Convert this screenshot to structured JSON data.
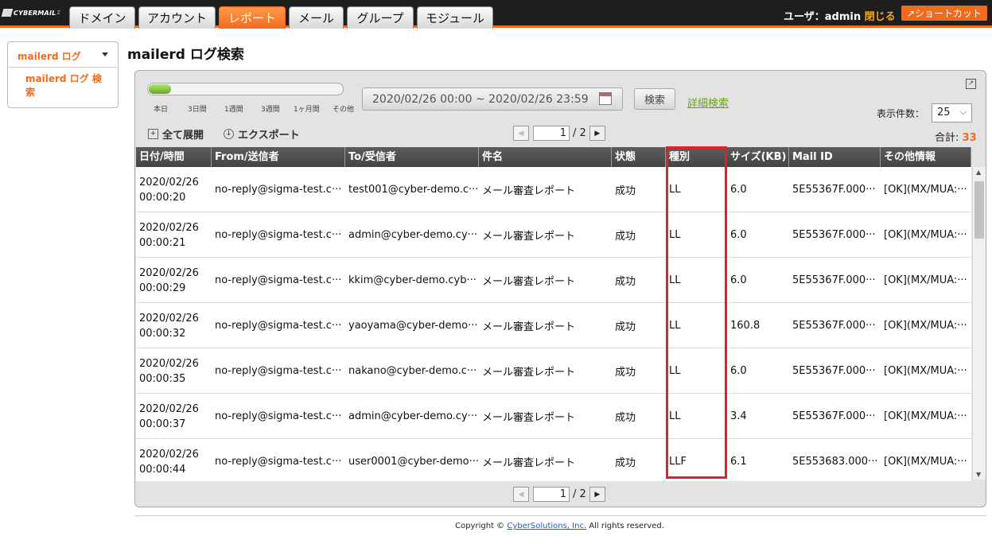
{
  "logo": {
    "text": "CYBERMAIL",
    "sup": "Σ"
  },
  "tabs": [
    {
      "label": "ドメイン"
    },
    {
      "label": "アカウント"
    },
    {
      "label": "レポート"
    },
    {
      "label": "メール"
    },
    {
      "label": "グループ"
    },
    {
      "label": "モジュール"
    }
  ],
  "active_tab": "レポート",
  "user": {
    "prefix": "ユーザ：admin",
    "close_label": "閉じる"
  },
  "shortcut_label": "ショートカット",
  "sidebar": {
    "header": "mailerd ログ",
    "item": "mailerd ログ 検索"
  },
  "page_title": "mailerd ログ検索",
  "slider_ticks": [
    "本日",
    "3日間",
    "1週間",
    "3週間",
    "1ヶ月間",
    "その他"
  ],
  "date_range": "2020/02/26 00:00 ~ 2020/02/26 23:59",
  "search_label": "検索",
  "advanced_search_label": "詳細検索",
  "per_page": {
    "label": "表示件数：",
    "value": "25"
  },
  "expand_all_label": "全て展開",
  "export_label": "エクスポート",
  "pager": {
    "current": "1",
    "total": "/ 2"
  },
  "total": {
    "label": "合計:",
    "value": "33"
  },
  "columns": [
    "日付/時間",
    "From/送信者",
    "To/受信者",
    "件名",
    "状態",
    "種別",
    "サイズ(KB)",
    "Mail ID",
    "その他情報"
  ],
  "rows": [
    [
      "2020/02/26 00:00:20",
      "no-reply@sigma-test.c···",
      "test001@cyber-demo.c···",
      "メール審査レポート",
      "成功",
      "LL",
      "6.0",
      "5E55367F.000···",
      "[OK](MX/MUA:···"
    ],
    [
      "2020/02/26 00:00:21",
      "no-reply@sigma-test.c···",
      "admin@cyber-demo.cy···",
      "メール審査レポート",
      "成功",
      "LL",
      "6.0",
      "5E55367F.000···",
      "[OK](MX/MUA:···"
    ],
    [
      "2020/02/26 00:00:29",
      "no-reply@sigma-test.c···",
      "kkim@cyber-demo.cyb···",
      "メール審査レポート",
      "成功",
      "LL",
      "6.0",
      "5E55367F.000···",
      "[OK](MX/MUA:···"
    ],
    [
      "2020/02/26 00:00:32",
      "no-reply@sigma-test.c···",
      "yaoyama@cyber-demo···",
      "メール審査レポート",
      "成功",
      "LL",
      "160.8",
      "5E55367F.000···",
      "[OK](MX/MUA:···"
    ],
    [
      "2020/02/26 00:00:35",
      "no-reply@sigma-test.c···",
      "nakano@cyber-demo.c···",
      "メール審査レポート",
      "成功",
      "LL",
      "6.0",
      "5E55367F.000···",
      "[OK](MX/MUA:···"
    ],
    [
      "2020/02/26 00:00:37",
      "no-reply@sigma-test.c···",
      "admin@cyber-demo.cy···",
      "メール審査レポート",
      "成功",
      "LL",
      "3.4",
      "5E55367F.000···",
      "[OK](MX/MUA:···"
    ],
    [
      "2020/02/26 00:00:44",
      "no-reply@sigma-test.c···",
      "user0001@cyber-demo···",
      "メール審査レポート",
      "成功",
      "LLF",
      "6.1",
      "5E553683.000···",
      "[OK](MX/MUA:···"
    ]
  ],
  "footer": {
    "prefix": "Copyright ©",
    "link": "CyberSolutions, Inc.",
    "suffix": "All rights reserved."
  },
  "colors": {
    "accent": "#f26b1d",
    "highlight": "#e0202a",
    "link": "#6aa31b"
  }
}
